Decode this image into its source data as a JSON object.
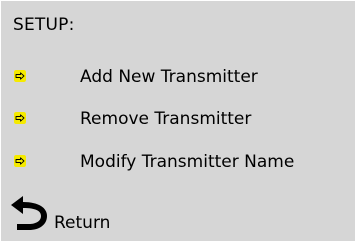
{
  "screen": {
    "title": "SETUP:",
    "background_color": "#d6d6d6",
    "accent_color": "#f5ea00"
  },
  "menu": {
    "items": [
      {
        "label": "Add New Transmitter",
        "icon": "arrow-right-icon"
      },
      {
        "label": "Remove Transmitter",
        "icon": "arrow-right-icon"
      },
      {
        "label": "Modify Transmitter Name",
        "icon": "arrow-right-icon"
      }
    ]
  },
  "footer": {
    "return_label": "Return",
    "return_icon": "return-arrow-icon"
  }
}
